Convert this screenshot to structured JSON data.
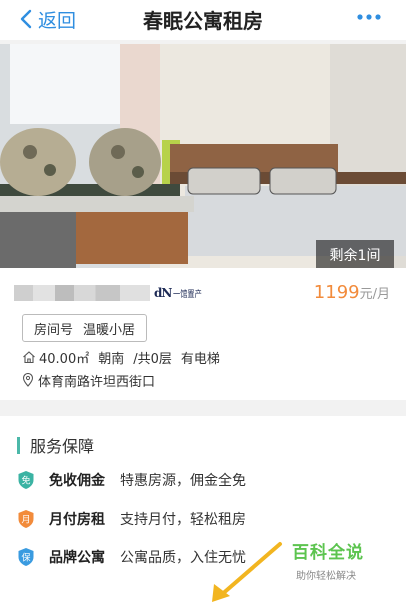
{
  "navbar": {
    "back_label": "返回",
    "title": "春眠公寓租房",
    "accent_color": "#2f8ee0"
  },
  "listing": {
    "remaining_label": "剩余1间",
    "brand_mark": "dN",
    "brand_text": "一馆置产",
    "price": "1199",
    "price_unit": "元/月",
    "room_label": "房间号",
    "room_name": "温暖小居",
    "area": "40.00㎡",
    "orientation": "朝南",
    "floors": "/共0层",
    "elevator": "有电梯",
    "address": "体育南路许坦西街口"
  },
  "services": {
    "heading": "服务保障",
    "items": [
      {
        "badge": "免",
        "badge_color": "#3bb3a3",
        "title": "免收佣金",
        "desc": "特惠房源，佣金全免"
      },
      {
        "badge": "月",
        "badge_color": "#f28b3b",
        "title": "月付房租",
        "desc": "支持月付，轻松租房"
      },
      {
        "badge": "保",
        "badge_color": "#3a9be0",
        "title": "品牌公寓",
        "desc": "公寓品质，入住无忧"
      }
    ]
  },
  "watermark": {
    "title": "百科全说",
    "subtitle": "助你轻松解决"
  }
}
